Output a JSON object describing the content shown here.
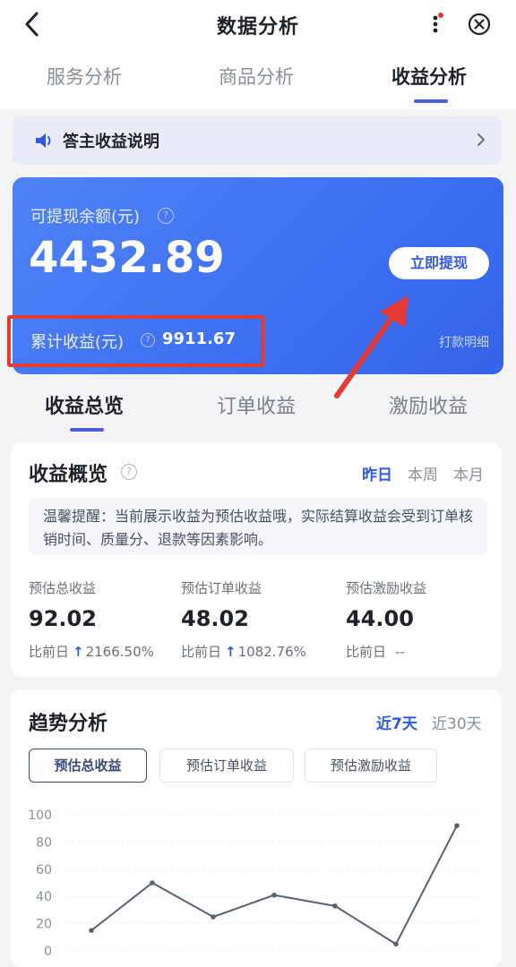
{
  "header": {
    "title": "数据分析"
  },
  "top_tabs": [
    {
      "label": "服务分析",
      "active": false
    },
    {
      "label": "商品分析",
      "active": false
    },
    {
      "label": "收益分析",
      "active": true
    }
  ],
  "notice": {
    "text": "答主收益说明"
  },
  "balance": {
    "withdrawable_label": "可提现余额(元)",
    "withdrawable_value": "4432.89",
    "withdraw_button": "立即提现",
    "cumulative_label": "累计收益(元)",
    "cumulative_value": "9911.67",
    "payment_detail_link": "打款明细"
  },
  "mid_tabs": [
    {
      "label": "收益总览",
      "active": true
    },
    {
      "label": "订单收益",
      "active": false
    },
    {
      "label": "激励收益",
      "active": false
    }
  ],
  "overview": {
    "title": "收益概览",
    "periods": [
      {
        "label": "昨日",
        "active": true
      },
      {
        "label": "本周",
        "active": false
      },
      {
        "label": "本月",
        "active": false
      }
    ],
    "tip": "温馨提醒：当前展示收益为预估收益哦，实际结算收益会受到订单核销时间、质量分、退款等因素影响。",
    "metrics": [
      {
        "label": "预估总收益",
        "value": "92.02",
        "compare_label": "比前日",
        "change": "2166.50%",
        "trend": "up"
      },
      {
        "label": "预估订单收益",
        "value": "48.02",
        "compare_label": "比前日",
        "change": "1082.76%",
        "trend": "up"
      },
      {
        "label": "预估激励收益",
        "value": "44.00",
        "compare_label": "比前日",
        "change": "--",
        "trend": "none"
      }
    ]
  },
  "trend": {
    "title": "趋势分析",
    "ranges": [
      {
        "label": "近7天",
        "active": true
      },
      {
        "label": "近30天",
        "active": false
      }
    ],
    "series_tabs": [
      {
        "label": "预估总收益",
        "active": true
      },
      {
        "label": "预估订单收益",
        "active": false
      },
      {
        "label": "预估激励收益",
        "active": false
      }
    ]
  },
  "colors": {
    "accent": "#2f5ae0",
    "card_blue": "#3d6ff0",
    "annotation_red": "#e53935"
  },
  "chart_data": {
    "type": "line",
    "y_ticks": [
      "0",
      "20",
      "40",
      "60",
      "80",
      "100"
    ],
    "ylim": [
      0,
      100
    ],
    "x": [
      1,
      2,
      3,
      4,
      5,
      6,
      7
    ],
    "values": [
      15,
      50,
      25,
      41,
      33,
      5,
      92
    ],
    "grid": true,
    "line_color": "#5b6270"
  }
}
